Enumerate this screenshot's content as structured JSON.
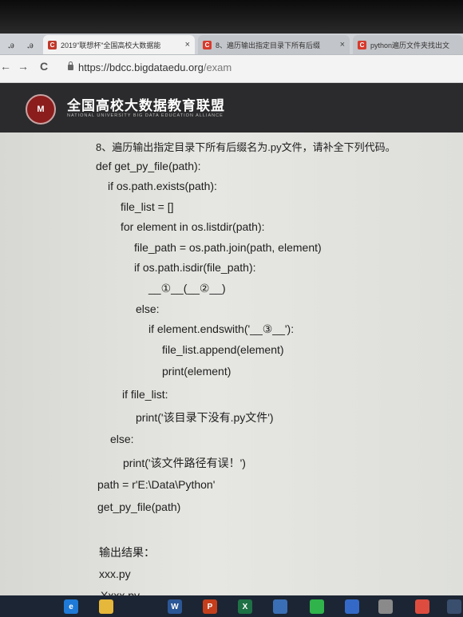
{
  "browser": {
    "tabs": [
      {
        "title": "2019\"联想杯\"全国高校大数据能",
        "favicon": "C"
      },
      {
        "title": "8、遍历输出指定目录下所有后缀",
        "favicon": "C"
      },
      {
        "title": "python遍历文件夹找出文",
        "favicon": "C"
      }
    ],
    "mini_tabs": [
      "ꭿ",
      "ꭿ"
    ],
    "close_glyph": "×",
    "back": "←",
    "forward": "→",
    "reload": "C",
    "url_host": "https://bdcc.bigdataedu.org",
    "url_path": "/exam"
  },
  "header": {
    "logo_text": "M",
    "title": "全国高校大数据教育联盟",
    "subtitle": "NATIONAL UNIVERSITY BIG DATA EDUCATION ALLIANCE"
  },
  "question": {
    "prompt": "8、遍历输出指定目录下所有后缀名为.py文件，请补全下列代码。",
    "code_lines": [
      "def get_py_file(path):",
      "if os.path.exists(path):",
      "file_list = []",
      "for element in os.listdir(path):",
      "file_path = os.path.join(path, element)",
      "if os.path.isdir(file_path):",
      "__①__(__②__)",
      "else:",
      "if element.endswith('__③__'):",
      "file_list.append(element)",
      "print(element)",
      "if file_list:",
      "print('该目录下没有.py文件')",
      "else:",
      "print('该文件路径有误！')",
      "path = r'E:\\Data\\Python'",
      "get_py_file(path)"
    ],
    "output_label": "输出结果：",
    "output_lines": [
      "xxx.py",
      "Xxxx.py"
    ]
  },
  "taskbar": {
    "icons": [
      "start-icon",
      "search-icon",
      "edge-icon",
      "explorer-icon",
      "word-icon",
      "powerpoint-icon",
      "excel-icon",
      "network-icon",
      "wechat-icon",
      "app-icon",
      "settings-icon",
      "chrome-icon",
      "app2-icon"
    ],
    "labels": [
      "",
      "",
      "e",
      "",
      "W",
      "P",
      "X",
      "",
      "",
      "",
      "",
      "",
      ""
    ],
    "colors": [
      "#1c2533",
      "#1c2533",
      "#1e7ad6",
      "#e5b73b",
      "#2b5797",
      "#c43e1c",
      "#1e7145",
      "#3a6fb5",
      "#2fb34a",
      "#3469c7",
      "#8a8a8a",
      "#de4c3f",
      "#3a4e6e"
    ]
  }
}
